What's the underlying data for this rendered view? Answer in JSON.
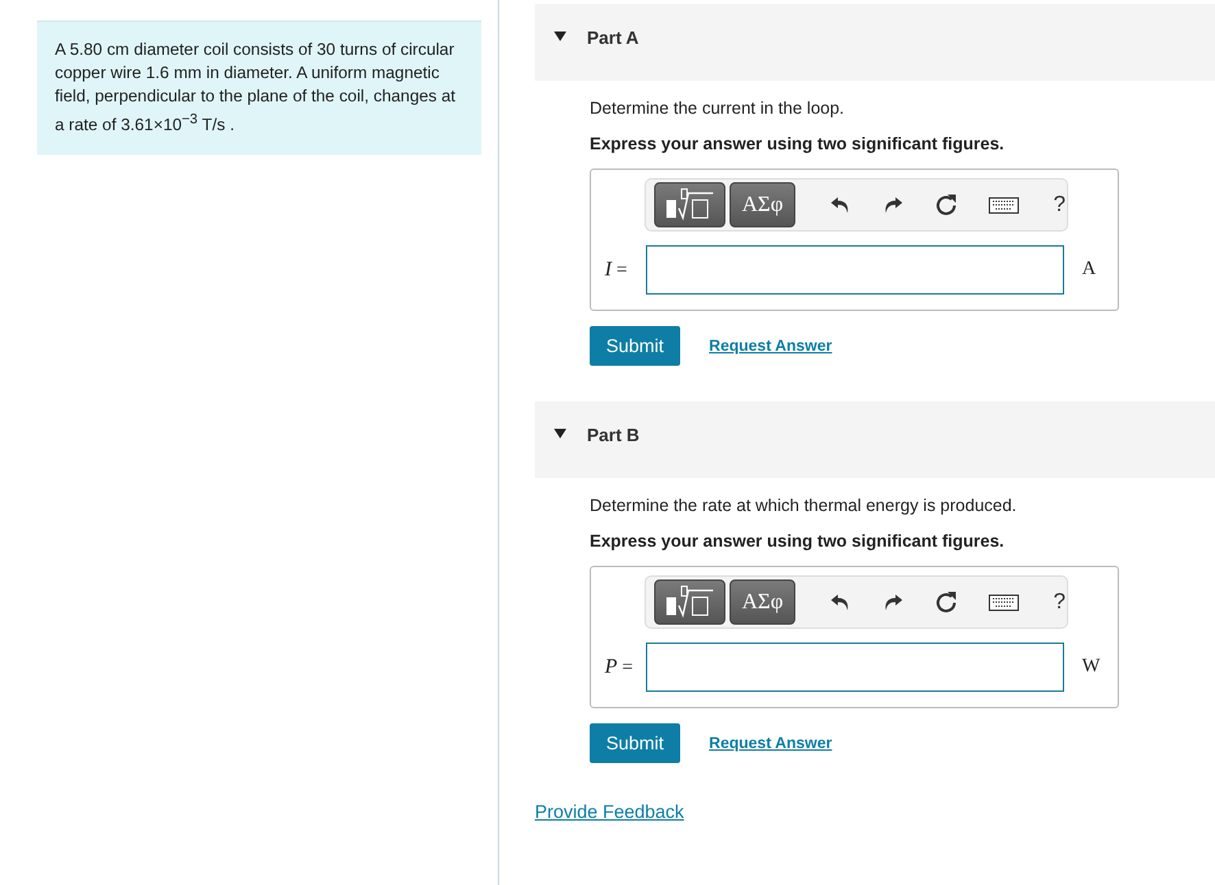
{
  "problem": {
    "text": "A 5.80 cm diameter coil consists of 30 turns of circular copper wire 1.6 mm in diameter. A uniform magnetic field, perpendicular to the plane of the coil, changes at a rate of 3.61×10$^{−3}$ T/s ."
  },
  "parts": [
    {
      "title": "Part A",
      "expanded": true,
      "question": "Determine the current in the loop.",
      "instruction": "Express your answer using two significant figures.",
      "symbols_button": "ΑΣφ",
      "help": "?",
      "variable": "I",
      "equals": "=",
      "unit": "A",
      "submit": "Submit",
      "request": "Request Answer"
    },
    {
      "title": "Part B",
      "expanded": true,
      "question": "Determine the rate at which thermal energy is produced.",
      "instruction": "Express your answer using two significant figures.",
      "symbols_button": "ΑΣφ",
      "help": "?",
      "variable": "P",
      "equals": "=",
      "unit": "W",
      "submit": "Submit",
      "request": "Request Answer"
    }
  ],
  "feedback_link": "Provide Feedback"
}
